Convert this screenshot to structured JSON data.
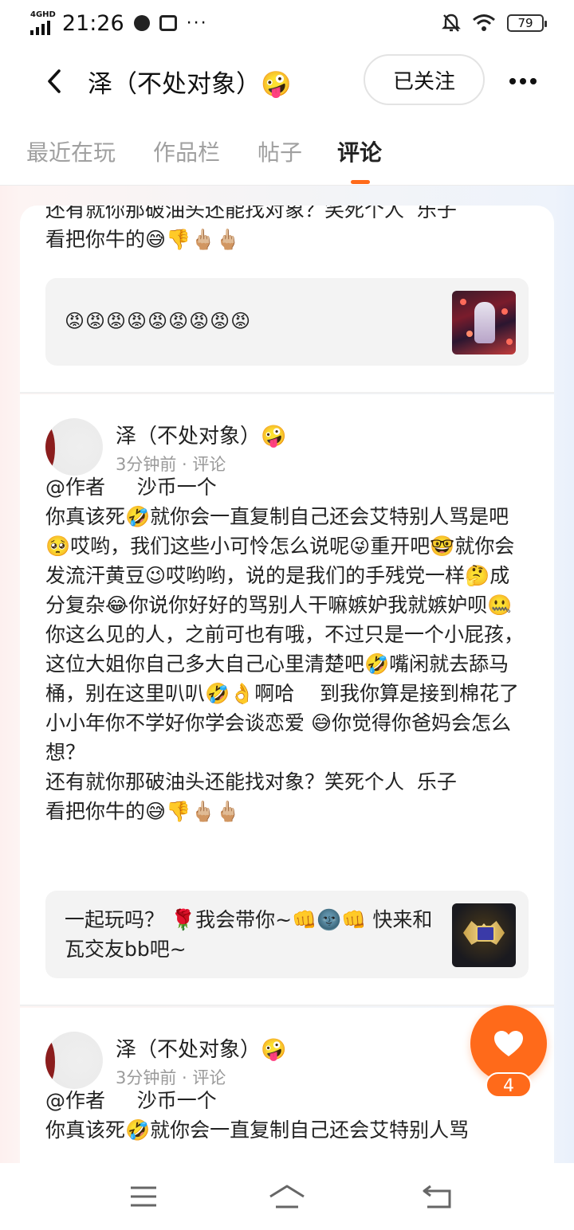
{
  "status_bar": {
    "network": "4GHD",
    "time": "21:26",
    "dots": "···",
    "battery": "79"
  },
  "header": {
    "title": "泽（不处对象）🤪",
    "follow_label": "已关注"
  },
  "tabs": [
    {
      "label": "最近在玩"
    },
    {
      "label": "作品栏"
    },
    {
      "label": "帖子"
    },
    {
      "label": "评论"
    }
  ],
  "comments": [
    {
      "text": "还有就你那破油头还能找对象？笑死个人  乐子\n看把你牛的😅👎🖕🏼🖕🏼",
      "game_text": "😡😡😡😡😡😡😡😡😡"
    },
    {
      "author": "泽（不处对象）🤪",
      "meta": "3分钟前 · 评论",
      "text": "@作者     沙币一个\n你真该死🤣就你会一直复制自己还会艾特别人骂是吧🥺哎哟，我们这些小可怜怎么说呢😜重开吧🤓就你会发流汗黄豆😉哎哟哟，说的是我们的手残党一样🤔成分复杂😂你说你好好的骂别人干嘛嫉妒我就嫉妒呗🤐你这么见的人，之前可也有哦，不过只是一个小屁孩，这位大姐你自己多大自己心里清楚吧🤣嘴闲就去舔马桶，别在这里叭叭🤣👌啊哈    到我你算是接到棉花了\n小小年你不学好你学会谈恋爱 😅你觉得你爸妈会怎么想？\n还有就你那破油头还能找对象？笑死个人  乐子\n看把你牛的😅👎🖕🏼🖕🏼",
      "game_text": "一起玩吗？ 🌹我会带你~👊🌚👊  快来和瓦交友bb吧~"
    },
    {
      "author": "泽（不处对象）🤪",
      "meta": "3分钟前 · 评论",
      "text": "@作者     沙币一个\n你真该死🤣就你会一直复制自己还会艾特别人骂"
    }
  ],
  "like": {
    "count": "4"
  },
  "colors": {
    "accent": "#ff6a1a"
  }
}
